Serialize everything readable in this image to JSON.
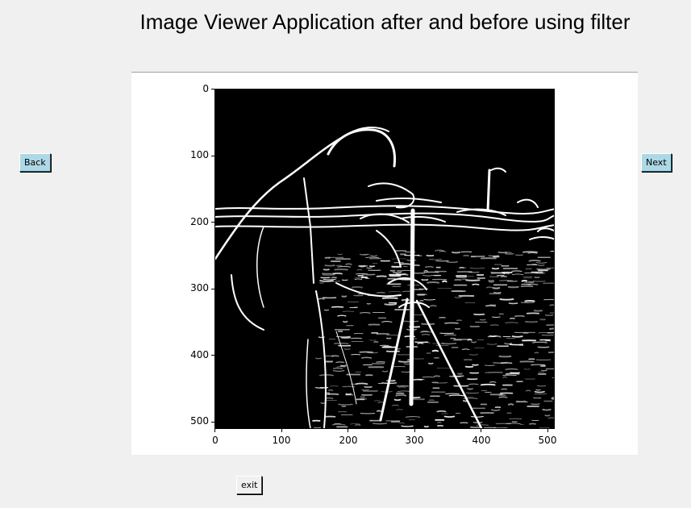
{
  "window": {
    "title": "Image Viewer Application after and before using filter"
  },
  "nav": {
    "back_label": "Back",
    "next_label": "Next",
    "exit_label": "exit"
  },
  "colors": {
    "nav_button_bg": "#add8e6",
    "window_bg": "#f0f0f0",
    "figure_bg": "#ffffff"
  },
  "figure": {
    "image_description": "camera-man-photo-edge-filtered",
    "x_ticks": [
      "0",
      "100",
      "200",
      "300",
      "400",
      "500"
    ],
    "y_ticks": [
      "0",
      "100",
      "200",
      "300",
      "400",
      "500"
    ],
    "x_range": [
      0,
      511
    ],
    "y_range": [
      0,
      511
    ]
  }
}
